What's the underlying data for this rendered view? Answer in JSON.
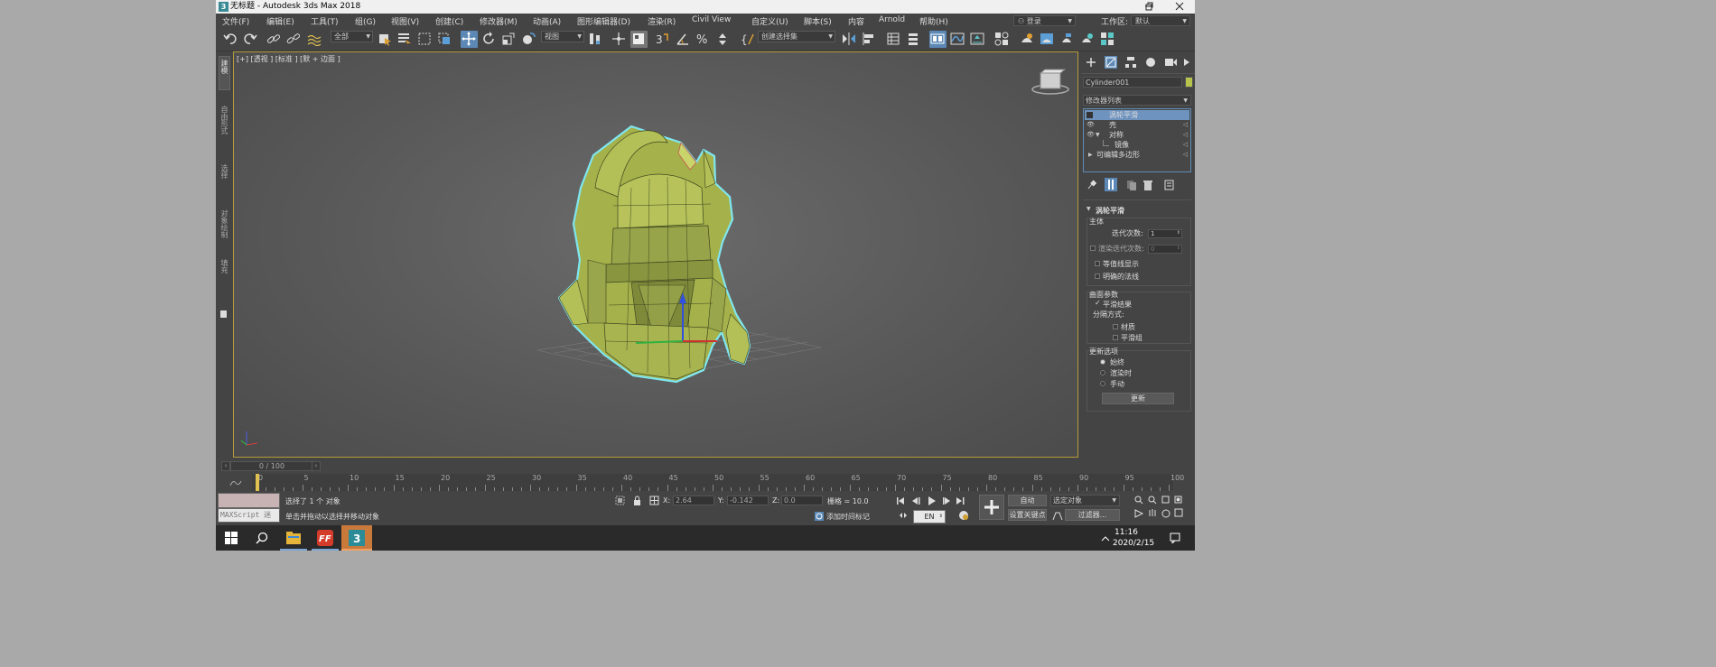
{
  "window": {
    "app_icon": "3",
    "title": "无标题 - Autodesk 3ds Max 2018",
    "buttons": [
      "minimize-icon",
      "restore-icon",
      "close-icon"
    ]
  },
  "menu": {
    "items": [
      "文件(F)",
      "编辑(E)",
      "工具(T)",
      "组(G)",
      "视图(V)",
      "创建(C)",
      "修改器(M)",
      "动画(A)",
      "图形编辑器(D)",
      "渲染(R)",
      "Civil View",
      "自定义(U)",
      "脚本(S)",
      "内容",
      "Arnold",
      "帮助(H)"
    ],
    "login": "登录",
    "workspace_label": "工作区:",
    "workspace_value": "默认"
  },
  "toolbar": {
    "filter_dropdown": "全部",
    "refcoord_dropdown": "视图",
    "selection_set": "创建选择集"
  },
  "left_rail": {
    "tabs": [
      "建模",
      "自由形式",
      "选择",
      "对象绘制",
      "填充"
    ]
  },
  "viewport": {
    "label": "[+] [透视] [标准] [默认明暗处理 + 边面]",
    "label_short": "[+] [透视 ] [标准 ] [默 + 边面 ]"
  },
  "command_panel": {
    "object_name": "Cylinder001",
    "object_color": "#b7c34a",
    "modifier_list": "修改器列表",
    "stack": [
      {
        "label": "涡轮平滑",
        "selected": true,
        "eye": false,
        "expand": false
      },
      {
        "label": "壳",
        "selected": false,
        "eye": true,
        "expand": false
      },
      {
        "label": "对称",
        "selected": false,
        "eye": true,
        "expand": true
      },
      {
        "label": "镜像",
        "selected": false,
        "eye": false,
        "expand": false
      },
      {
        "label": "可编辑多边形",
        "selected": false,
        "eye": false,
        "expand": true
      }
    ],
    "rollout_title": "涡轮平滑",
    "main_group": "主体",
    "iterations_label": "迭代次数:",
    "iterations_value": "1",
    "render_iters_label": "渲染迭代次数:",
    "render_iters_value": "0",
    "isoline_label": "等值线显示",
    "explicit_normals_label": "明确的法线",
    "surface_group": "曲面参数",
    "smooth_result_label": "平滑结果",
    "separate_by_label": "分隔方式:",
    "materials_label": "材质",
    "smoothing_groups_label": "平滑组",
    "update_group": "更新选项",
    "always_label": "始终",
    "when_rendering_label": "渲染时",
    "manually_label": "手动",
    "update_button": "更新"
  },
  "timeline": {
    "slider_value": "0 / 100",
    "ticks": [
      "0",
      "5",
      "10",
      "15",
      "20",
      "25",
      "30",
      "35",
      "40",
      "45",
      "50",
      "55",
      "60",
      "65",
      "70",
      "75",
      "80",
      "85",
      "90",
      "95",
      "100"
    ]
  },
  "status": {
    "maxscript_label": "MAXScript 迷",
    "selected_text": "选择了 1 个 对象",
    "prompt_text": "单击并拖动以选择并移动对象",
    "x_label": "X:",
    "x_value": "2.64",
    "y_label": "Y:",
    "y_value": "-0.142",
    "z_label": "Z:",
    "z_value": "0.0",
    "grid_text": "栅格 = 10.0",
    "add_time_tag": "添加时间标记",
    "auto_button": "自动",
    "selected_objects_dropdown": "选定对象",
    "set_key_button": "设置关键点",
    "filters_button": "过滤器...",
    "frame_value": "0"
  },
  "taskbar": {
    "time": "11:16",
    "date": "2020/2/15",
    "lang": "EN"
  }
}
